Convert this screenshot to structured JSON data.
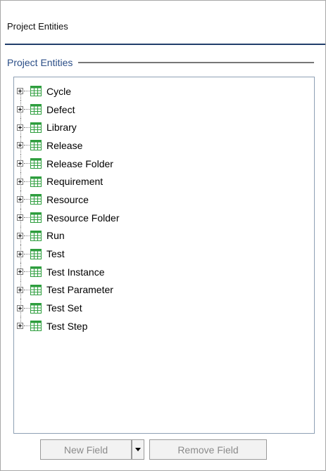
{
  "header": {
    "title": "Project Entities"
  },
  "group": {
    "title": "Project Entities"
  },
  "tree": {
    "items": [
      {
        "label": "Cycle",
        "icon": "table-icon"
      },
      {
        "label": "Defect",
        "icon": "table-icon"
      },
      {
        "label": "Library",
        "icon": "table-icon"
      },
      {
        "label": "Release",
        "icon": "table-icon"
      },
      {
        "label": "Release Folder",
        "icon": "table-icon"
      },
      {
        "label": "Requirement",
        "icon": "table-icon"
      },
      {
        "label": "Resource",
        "icon": "table-icon"
      },
      {
        "label": "Resource Folder",
        "icon": "table-icon"
      },
      {
        "label": "Run",
        "icon": "table-icon"
      },
      {
        "label": "Test",
        "icon": "table-icon"
      },
      {
        "label": "Test Instance",
        "icon": "table-icon"
      },
      {
        "label": "Test Parameter",
        "icon": "table-icon"
      },
      {
        "label": "Test Set",
        "icon": "table-icon"
      },
      {
        "label": "Test Step",
        "icon": "table-icon"
      }
    ]
  },
  "buttons": {
    "new_field": "New Field",
    "remove_field": "Remove Field"
  },
  "colors": {
    "header_rule": "#213e6b",
    "group_title": "#2b4e87",
    "icon_green": "#2e9e3e",
    "disabled_text": "#8b8b8b"
  }
}
